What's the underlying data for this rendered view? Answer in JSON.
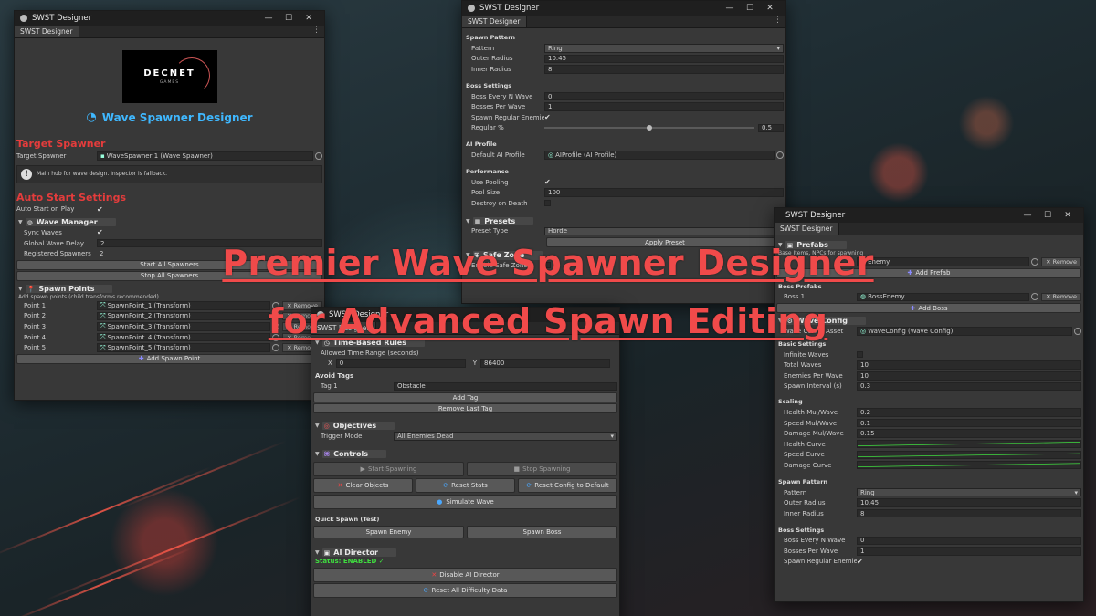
{
  "headline": {
    "line1": "Premier Wave Spawner Designer",
    "line2": "for Advanced Spawn Editing"
  },
  "window_common": {
    "title": "SWST Designer",
    "tab": "SWST Designer",
    "minimize": "—",
    "maximize": "☐",
    "close": "✕"
  },
  "win1": {
    "logo_text": "DECNET",
    "logo_sub": "GAMES",
    "designer_title": "Wave Spawner Designer",
    "target_spawner_header": "Target Spawner",
    "target_spawner_label": "Target Spawner",
    "target_spawner_value": "WaveSpawner 1 (Wave Spawner)",
    "info_text": "Main hub for wave design. Inspector is fallback.",
    "auto_start_header": "Auto Start Settings",
    "auto_start_label": "Auto Start on Play",
    "wave_manager_title": "Wave Manager",
    "sync_waves_label": "Sync Waves",
    "global_delay_label": "Global Wave Delay",
    "global_delay_value": "2",
    "registered_label": "Registered Spawners",
    "registered_value": "2",
    "start_all": "Start All Spawners",
    "stop_all": "Stop All Spawners",
    "spawn_points_title": "Spawn Points",
    "spawn_points_note": "Add spawn points (child transforms recommended).",
    "points": [
      {
        "label": "Point 1",
        "value": "SpawnPoint_1 (Transform)"
      },
      {
        "label": "Point 2",
        "value": "SpawnPoint_2 (Transform)"
      },
      {
        "label": "Point 3",
        "value": "SpawnPoint_3 (Transform)"
      },
      {
        "label": "Point 4",
        "value": "SpawnPoint_4 (Transform)"
      },
      {
        "label": "Point 5",
        "value": "SpawnPoint_5 (Transform)"
      }
    ],
    "remove": "Remove",
    "add_spawn_point": "Add Spawn Point"
  },
  "win2": {
    "spawn_pattern_header": "Spawn Pattern",
    "pattern_label": "Pattern",
    "pattern_value": "Ring",
    "outer_radius_label": "Outer Radius",
    "outer_radius_value": "10.45",
    "inner_radius_label": "Inner Radius",
    "inner_radius_value": "8",
    "boss_settings_header": "Boss Settings",
    "boss_every_label": "Boss Every N Wave",
    "boss_every_value": "0",
    "bosses_per_wave_label": "Bosses Per Wave",
    "bosses_per_wave_value": "1",
    "spawn_regular_label": "Spawn Regular Enemies",
    "regular_pct_label": "Regular %",
    "regular_pct_value": "0.5",
    "regular_pct_fraction": 0.5,
    "ai_profile_header": "AI Profile",
    "default_ai_label": "Default AI Profile",
    "default_ai_value": "AIProfile (AI Profile)",
    "performance_header": "Performance",
    "use_pooling_label": "Use Pooling",
    "pool_size_label": "Pool Size",
    "pool_size_value": "100",
    "destroy_label": "Destroy on Death",
    "presets_title": "Presets",
    "preset_type_label": "Preset Type",
    "preset_type_value": "Horde",
    "apply_preset": "Apply Preset",
    "safe_zone_title": "Safe Zone",
    "enable_safe_zone_label": "Enable Safe Zone"
  },
  "win3": {
    "time_rules_title": "Time-Based Rules",
    "allowed_time_label": "Allowed Time Range (seconds)",
    "x_label": "X",
    "x_value": "0",
    "y_label": "Y",
    "y_value": "86400",
    "avoid_tags_header": "Avoid Tags",
    "tag1_label": "Tag 1",
    "tag1_value": "Obstacle",
    "add_tag": "Add Tag",
    "remove_last_tag": "Remove Last Tag",
    "objectives_title": "Objectives",
    "trigger_mode_label": "Trigger Mode",
    "trigger_mode_value": "All Enemies Dead",
    "controls_title": "Controls",
    "start_spawning": "Start Spawning",
    "stop_spawning": "Stop Spawning",
    "clear_objects": "Clear Objects",
    "reset_stats": "Reset Stats",
    "reset_config": "Reset Config to Default",
    "simulate_wave": "Simulate Wave",
    "quick_spawn_header": "Quick Spawn (Test)",
    "spawn_enemy": "Spawn Enemy",
    "spawn_boss": "Spawn Boss",
    "ai_director_title": "AI Director",
    "status": "Status: ENABLED ✓",
    "disable_ai": "Disable AI Director",
    "reset_difficulty": "Reset All Difficulty Data"
  },
  "win4": {
    "prefabs_title": "Prefabs",
    "prefabs_note": "Base Items, NPCs for spawning",
    "enemy_value": "Enemy",
    "add_prefab": "Add Prefab",
    "boss_prefabs_header": "Boss Prefabs",
    "boss1_label": "Boss 1",
    "boss1_value": "BossEnemy",
    "add_boss": "Add Boss",
    "wave_config_title": "Wave Config",
    "wave_config_asset_label": "Wave Config Asset",
    "wave_config_asset_value": "WaveConfig (Wave Config)",
    "basic_settings_header": "Basic Settings",
    "infinite_waves_label": "Infinite Waves",
    "total_waves_label": "Total Waves",
    "total_waves_value": "10",
    "enemies_per_wave_label": "Enemies Per Wave",
    "enemies_per_wave_value": "10",
    "spawn_interval_label": "Spawn Interval (s)",
    "spawn_interval_value": "0.3",
    "scaling_header": "Scaling",
    "health_mul_label": "Health Mul/Wave",
    "health_mul_value": "0.2",
    "speed_mul_label": "Speed Mul/Wave",
    "speed_mul_value": "0.1",
    "damage_mul_label": "Damage Mul/Wave",
    "damage_mul_value": "0.15",
    "health_curve_label": "Health Curve",
    "speed_curve_label": "Speed Curve",
    "damage_curve_label": "Damage Curve",
    "spawn_pattern_header": "Spawn Pattern",
    "pattern_label": "Pattern",
    "pattern_value": "Ring",
    "outer_radius_label": "Outer Radius",
    "outer_radius_value": "10.45",
    "inner_radius_label": "Inner Radius",
    "inner_radius_value": "8",
    "boss_settings_header": "Boss Settings",
    "boss_every_label": "Boss Every N Wave",
    "boss_every_value": "0",
    "bosses_per_wave_label": "Bosses Per Wave",
    "bosses_per_wave_value": "1",
    "spawn_regular_label": "Spawn Regular Enemies",
    "remove": "Remove"
  },
  "colors": {
    "accent_red": "#e53c3c",
    "headline_red": "#f04a4a",
    "status_green": "#3fdc3f",
    "designer_title_blue": "#3fb8ff"
  }
}
